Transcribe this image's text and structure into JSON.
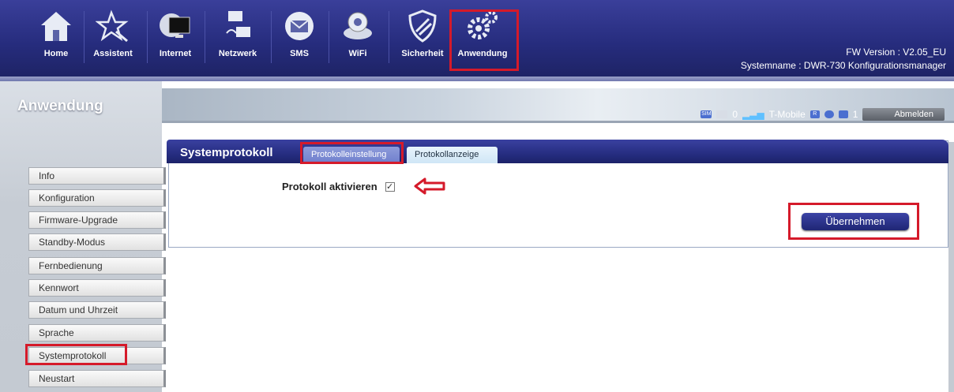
{
  "nav": {
    "items": [
      {
        "label": "Home",
        "icon": "home-icon"
      },
      {
        "label": "Assistent",
        "icon": "wizard-icon"
      },
      {
        "label": "Internet",
        "icon": "globe-monitor-icon"
      },
      {
        "label": "Netzwerk",
        "icon": "network-icon"
      },
      {
        "label": "SMS",
        "icon": "envelope-icon"
      },
      {
        "label": "WiFi",
        "icon": "wifi-router-icon"
      },
      {
        "label": "Sicherheit",
        "icon": "shield-icon"
      },
      {
        "label": "Anwendung",
        "icon": "gears-icon"
      }
    ],
    "active": "Anwendung"
  },
  "header": {
    "fw_version": "FW Version : V2.05_EU",
    "system_name": "Systemname : DWR-730 Konfigurationsmanager"
  },
  "status": {
    "sms_count": "0",
    "carrier": "T-Mobile",
    "clients": "1",
    "logout_label": "Abmelden"
  },
  "sidebar": {
    "title": "Anwendung",
    "items": [
      {
        "label": "Info"
      },
      {
        "label": "Konfiguration"
      },
      {
        "label": "Firmware-Upgrade"
      },
      {
        "label": "Standby-Modus"
      },
      {
        "label": "Fernbedienung"
      },
      {
        "label": "Kennwort"
      },
      {
        "label": "Datum und Uhrzeit"
      },
      {
        "label": "Sprache"
      },
      {
        "label": "Systemprotokoll"
      },
      {
        "label": "Neustart"
      }
    ],
    "active": "Systemprotokoll"
  },
  "panel": {
    "title": "Systemprotokoll",
    "tabs": [
      {
        "label": "Protokolleinstellung"
      },
      {
        "label": "Protokollanzeige"
      }
    ],
    "active_tab": "Protokolleinstellung",
    "log_enable_label": "Protokoll aktivieren",
    "log_enabled": true,
    "apply_label": "Übernehmen"
  },
  "colors": {
    "highlight": "#d51a2a",
    "nav_bg": "#262c7d"
  }
}
